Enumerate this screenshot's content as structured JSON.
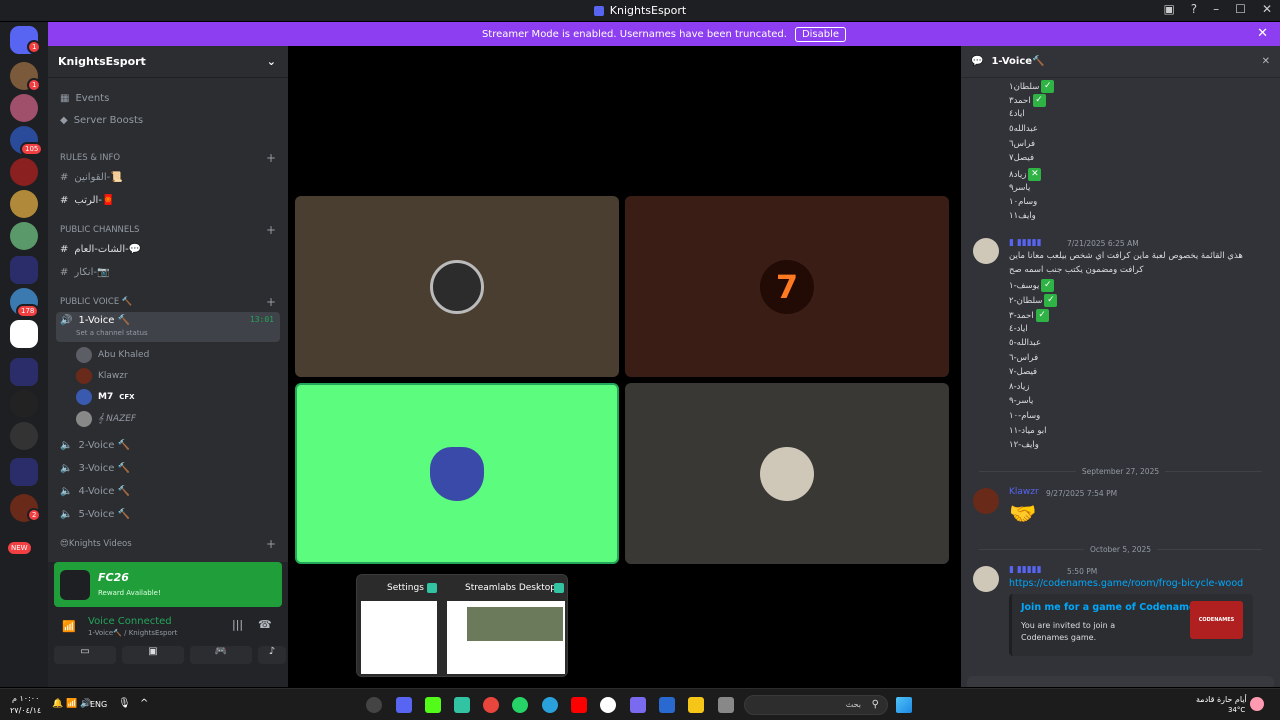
{
  "window": {
    "title": "KnightsEsport"
  },
  "banner": {
    "text": "Streamer Mode is enabled. Usernames have been truncated.",
    "button": "Disable"
  },
  "server_badges": [
    "1",
    "1",
    "105",
    "178",
    "2",
    "NEW"
  ],
  "guild": {
    "name": "KnightsEsport"
  },
  "sidebar": {
    "events": "Events",
    "boosts": "Server Boosts",
    "cat_rules": "RULES & INFO",
    "ch_rules1": "القوانين-📜",
    "ch_rules2": "الرتب-🧧",
    "cat_public": "PUBLIC CHANNELS",
    "ch_pub1": "الشات-العام-💬",
    "ch_pub2": "انكار-📷",
    "cat_voice": "PUBLIC VOICE 🔨",
    "voice1": "1-Voice 🔨",
    "voice1_time": "13:01",
    "voice1_status": "Set a channel status",
    "members": [
      "Abu Khaled",
      "Klawzr",
      "M7",
      "𝄞 NAZEF"
    ],
    "member_tag": "CFX",
    "voice2": "2-Voice 🔨",
    "voice3": "3-Voice 🔨",
    "voice4": "4-Voice 🔨",
    "voice5": "5-Voice 🔨",
    "cat_videos": "😍Knights Videos"
  },
  "userpanel": {
    "reward_title": "FC26",
    "reward_sub": "Reward Available!",
    "voice_status": "Voice Connected",
    "voice_channel": "1-Voice🔨 / KnightsEsport"
  },
  "popup": {
    "tab1": "Settings",
    "tab2": "Streamlabs Desktop"
  },
  "chat": {
    "channel": "1-Voice🔨",
    "list1": [
      "سلطان١",
      "احمد٣",
      "اياد٤",
      "عبدالله٥",
      "فراس٦",
      "فيصل٧",
      "زياد٨",
      "ياسر٩",
      "وسام١٠",
      "وايف١١"
    ],
    "msg2_time": "7/21/2025 6:25 AM",
    "msg2_text1": "هذي القائمة يخصوص لعبة ماين كرافت اي شخص بيلعب معانا ماين",
    "msg2_text2": "كرافت ومضمون يكتب جنب اسمه صح",
    "list2": [
      "يوسف-١",
      "سلطان-٢",
      "احمد-٣",
      "اياد-٤",
      "عبدالله-٥",
      "فراس-٦",
      "فيصل-٧",
      "زياد-٨",
      "ياسر-٩",
      "وسام-١٠",
      "ابو مياد-١١",
      "وايف-١٢"
    ],
    "date1": "September 27, 2025",
    "msg3_author": "Klawzr",
    "msg3_time": "9/27/2025 7:54 PM",
    "msg3_emoji": "🤝",
    "date2": "October 5, 2025",
    "msg4_time": "5:50 PM",
    "msg4_link": "https://codenames.game/room/frog-bicycle-wood",
    "embed_title": "Join me for a game of Codenames",
    "embed_desc": "You are invited to join a Codenames game.",
    "embed_img": "CODENAMES"
  },
  "taskbar": {
    "clock_time": "١٠:٠٠ م",
    "clock_date": "٢٧/٠٤/١٤",
    "lang": "ENG",
    "search": "بحث",
    "weather_label": "أيام حارة قادمة",
    "weather_temp": "34°C"
  },
  "colors": {
    "accent": "#8c3ef0",
    "green": "#23a55a",
    "link": "#00a8fc"
  }
}
